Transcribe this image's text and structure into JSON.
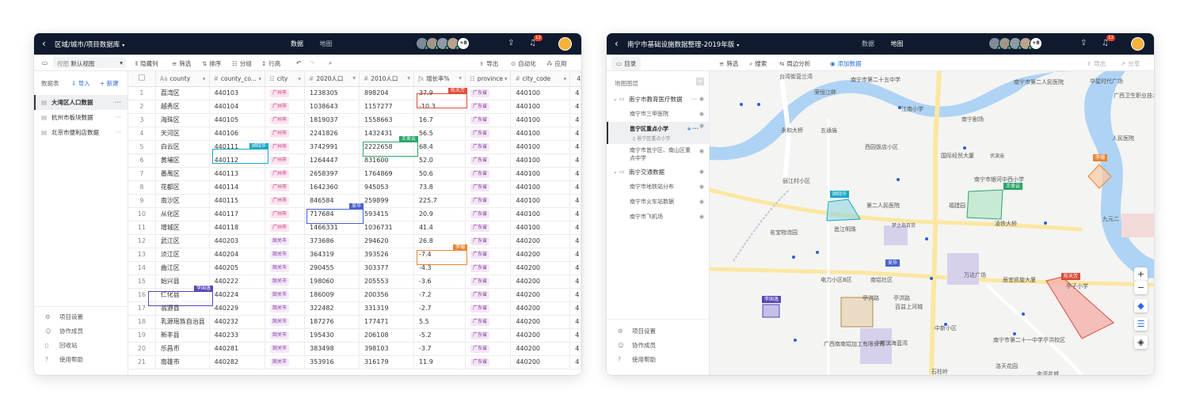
{
  "left": {
    "title": "区域/城市/项目数据库",
    "tabs": [
      "数据",
      "地图"
    ],
    "avatars_more": "+8",
    "notif": "12",
    "toolbar": {
      "view_label": "视图",
      "view_value": "默认视图",
      "hide": "隐藏列",
      "filter": "筛选",
      "sort": "排序",
      "group": "分组",
      "rowh": "行高",
      "export": "导出",
      "auto": "自动化",
      "app": "应用"
    },
    "sidebar": {
      "header": "数据表",
      "import": "导入",
      "new": "新建",
      "items": [
        "大湾区人口数据",
        "杭州市板块数据",
        "北京市便利店数据"
      ],
      "bottom": [
        "项目设置",
        "协作成员",
        "回收站",
        "使用帮助"
      ]
    },
    "columns": [
      "county",
      "county_co...",
      "city",
      "2020人口",
      "2010人口",
      "增长率%",
      "province",
      "city_code",
      "4"
    ],
    "rows": [
      [
        "1",
        "荔湾区",
        "440103",
        "广州市",
        "1238305",
        "898204",
        "37.9",
        "广东省",
        "440100",
        "4"
      ],
      [
        "2",
        "越秀区",
        "440104",
        "广州市",
        "1038643",
        "1157277",
        "-10.3",
        "广东省",
        "440100",
        "4"
      ],
      [
        "3",
        "海珠区",
        "440105",
        "广州市",
        "1819037",
        "1558663",
        "16.7",
        "广东省",
        "440100",
        "4"
      ],
      [
        "4",
        "天河区",
        "440106",
        "广州市",
        "2241826",
        "1432431",
        "56.5",
        "广东省",
        "440100",
        "4"
      ],
      [
        "5",
        "白云区",
        "440111",
        "广州市",
        "3742991",
        "2222658",
        "68.4",
        "广东省",
        "440100",
        "4"
      ],
      [
        "6",
        "黄埔区",
        "440112",
        "广州市",
        "1264447",
        "831600",
        "52.0",
        "广东省",
        "440100",
        "4"
      ],
      [
        "7",
        "番禺区",
        "440113",
        "广州市",
        "2658397",
        "1764869",
        "50.6",
        "广东省",
        "440100",
        "4"
      ],
      [
        "8",
        "花都区",
        "440114",
        "广州市",
        "1642360",
        "945053",
        "73.8",
        "广东省",
        "440100",
        "4"
      ],
      [
        "9",
        "南沙区",
        "440115",
        "广州市",
        "846584",
        "259899",
        "225.7",
        "广东省",
        "440100",
        "4"
      ],
      [
        "10",
        "从化区",
        "440117",
        "广州市",
        "717684",
        "593415",
        "20.9",
        "广东省",
        "440100",
        "4"
      ],
      [
        "11",
        "增城区",
        "440118",
        "广州市",
        "1466331",
        "1036731",
        "41.4",
        "广东省",
        "440100",
        "4"
      ],
      [
        "12",
        "武江区",
        "440203",
        "韶关市",
        "373686",
        "294620",
        "26.8",
        "广东省",
        "440200",
        "4"
      ],
      [
        "13",
        "浈江区",
        "440204",
        "韶关市",
        "364319",
        "393526",
        "-7.4",
        "广东省",
        "440200",
        "4"
      ],
      [
        "14",
        "曲江区",
        "440205",
        "韶关市",
        "290455",
        "303377",
        "-4.3",
        "广东省",
        "440200",
        "4"
      ],
      [
        "15",
        "始兴县",
        "440222",
        "韶关市",
        "198060",
        "205553",
        "-3.6",
        "广东省",
        "440200",
        "4"
      ],
      [
        "16",
        "仁化县",
        "440224",
        "韶关市",
        "186009",
        "200356",
        "-7.2",
        "广东省",
        "440200",
        "4"
      ],
      [
        "17",
        "翁源县",
        "440229",
        "韶关市",
        "322482",
        "331319",
        "-2.7",
        "广东省",
        "440200",
        "4"
      ],
      [
        "18",
        "乳源瑶族自治县",
        "440232",
        "韶关市",
        "187276",
        "177471",
        "5.5",
        "广东省",
        "440200",
        "4"
      ],
      [
        "19",
        "新丰县",
        "440233",
        "韶关市",
        "195430",
        "206108",
        "-5.2",
        "广东省",
        "440200",
        "4"
      ],
      [
        "20",
        "乐昌市",
        "440281",
        "韶关市",
        "383498",
        "398103",
        "-3.7",
        "广东省",
        "440200",
        "4"
      ],
      [
        "21",
        "南雄市",
        "440282",
        "韶关市",
        "353916",
        "316179",
        "11.9",
        "广东省",
        "440200",
        "4"
      ]
    ],
    "collab": [
      "陈天芳",
      "顾晓华",
      "王舍云",
      "吴华",
      "李珊",
      "李国逸"
    ]
  },
  "right": {
    "title": "南宁市基础设施数据整理-2019年版",
    "tabs": [
      "数据",
      "地图"
    ],
    "avatars_more": "+8",
    "notif": "12",
    "toolbar": {
      "catalog": "目录",
      "filter": "筛选",
      "search": "搜索",
      "nearby": "周边分析",
      "add": "添加数据",
      "export": "导出",
      "share": "分享"
    },
    "layers_header": "地图图层",
    "layers": [
      "南宁市教育医疗数据",
      "南宁市三甲医院",
      "邕宁区重点小学",
      "邕宁区重点小学",
      "南宁市邕宁区、南山区重点中学",
      "南宁交通数据",
      "南宁市地铁站分布",
      "南宁市火车站数据",
      "南宁市飞机场"
    ],
    "bottom": [
      "项目设置",
      "协作成员",
      "使用帮助"
    ],
    "map_labels": [
      "台湾街营兰湾",
      "南宁市第二十五中学",
      "荣恒江畔",
      "江南小学",
      "南宁剧场",
      "五通庙",
      "华星时代广场",
      "广西卫生职业技术学院",
      "南宁市第二人民医院",
      "永和大桥",
      "西园饭店小区",
      "国际经贸大厦",
      "伏波庙",
      "人民医院",
      "南宁市银河中西小学",
      "丽江村小区",
      "第二人民医院",
      "福建园",
      "凌铁大桥",
      "名宝物流园",
      "邕江明珠",
      "梦之岛百货",
      "九元二",
      "电力小区B区",
      "南铝社区",
      "万达广场",
      "居宜凯旋大厦",
      "亭子小学",
      "亭洪路",
      "百益上河城",
      "南宁市第二十一中学亭洪校区",
      "中新小区",
      "中都滨海蓝湾",
      "广西南南铝加工有限公司",
      "洛天花园",
      "石柱岭",
      "亭洪路",
      "金湾花城"
    ],
    "map_tags": [
      "顾晓华",
      "王舍云",
      "吴华",
      "李国逸",
      "陈天芳",
      "李珊"
    ]
  }
}
